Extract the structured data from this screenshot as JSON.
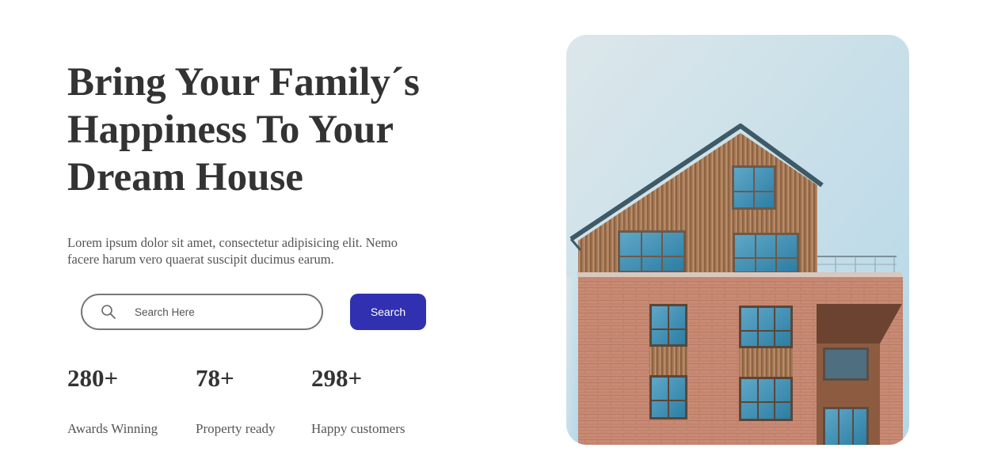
{
  "hero": {
    "title_lines": [
      "Bring Your Family´s",
      "Happiness To Your",
      "Dream House"
    ],
    "description": "Lorem ipsum dolor sit amet, consectetur adipisicing elit. Nemo facere harum vero quaerat suscipit ducimus earum."
  },
  "search": {
    "placeholder": "Search Here",
    "button_label": "Search",
    "icon": "search-icon",
    "button_color": "#3030b0"
  },
  "stats": [
    {
      "value": "280+",
      "label": "Awards Winning"
    },
    {
      "value": "78+",
      "label": "Property ready"
    },
    {
      "value": "298+",
      "label": "Happy customers"
    }
  ],
  "colors": {
    "title": "#333333",
    "text": "#555555"
  }
}
